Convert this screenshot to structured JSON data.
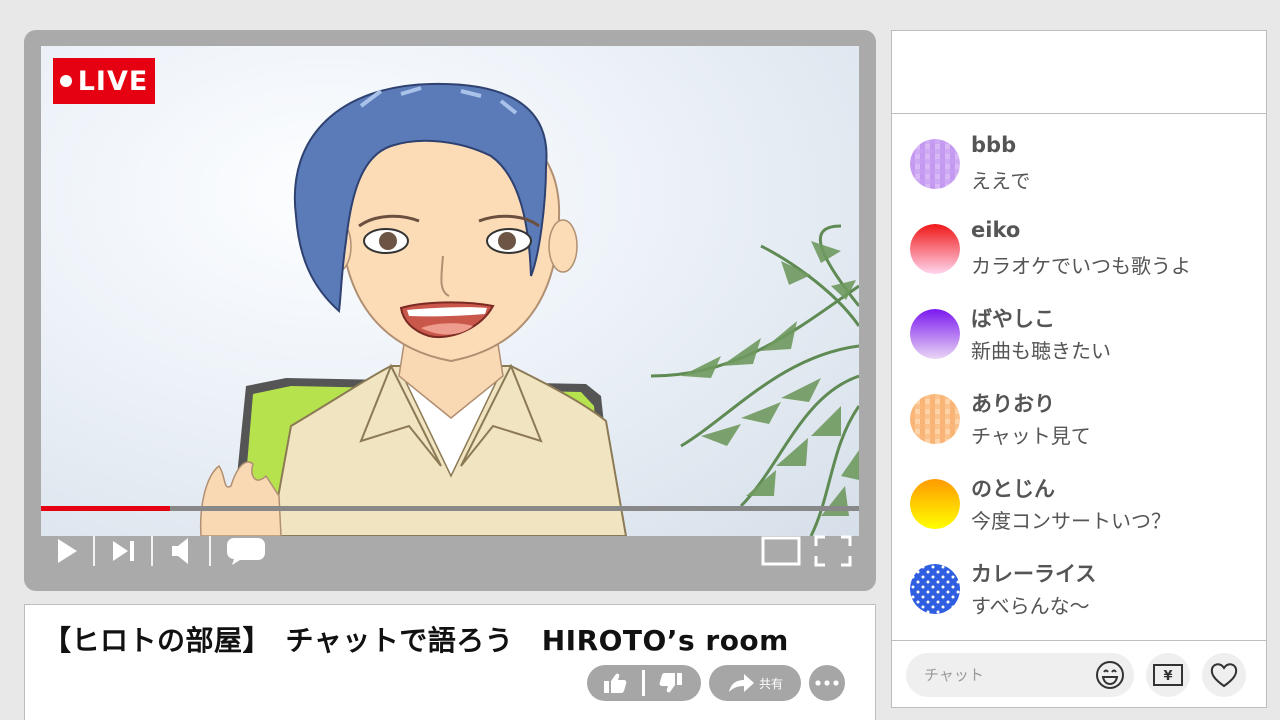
{
  "player": {
    "live_label": "LIVE",
    "progress_fraction": 0.158,
    "accent_color": "#e50012",
    "controls": [
      "play-icon",
      "next-icon",
      "volume-icon",
      "subtitles-icon",
      "theater-mode-icon",
      "fullscreen-icon"
    ]
  },
  "video_info": {
    "title": "【ヒロトの部屋】　チャットで語ろう　HIROTO’s room",
    "share_label": "共有",
    "actions": [
      "like-icon",
      "dislike-icon",
      "share-icon",
      "more-icon"
    ]
  },
  "chat": {
    "messages": [
      {
        "name": "bbb",
        "text": "ええで",
        "avatar": "purple-checker"
      },
      {
        "name": "eiko",
        "text": "カラオケでいつも歌うよ",
        "avatar": "red-gradient"
      },
      {
        "name": "ばやしこ",
        "text": "新曲も聴きたい",
        "avatar": "violet-gradient"
      },
      {
        "name": "ありおり",
        "text": "チャット見て",
        "avatar": "orange-checker"
      },
      {
        "name": "のとじん",
        "text": "今度コンサートいつ？",
        "avatar": "yellow-gradient"
      },
      {
        "name": "カレーライス",
        "text": "すべらんな〜",
        "avatar": "blue-polka-dot"
      }
    ],
    "input_placeholder": "チャット",
    "footer_buttons": [
      "smile-icon",
      "yen-icon",
      "heart-icon"
    ]
  }
}
